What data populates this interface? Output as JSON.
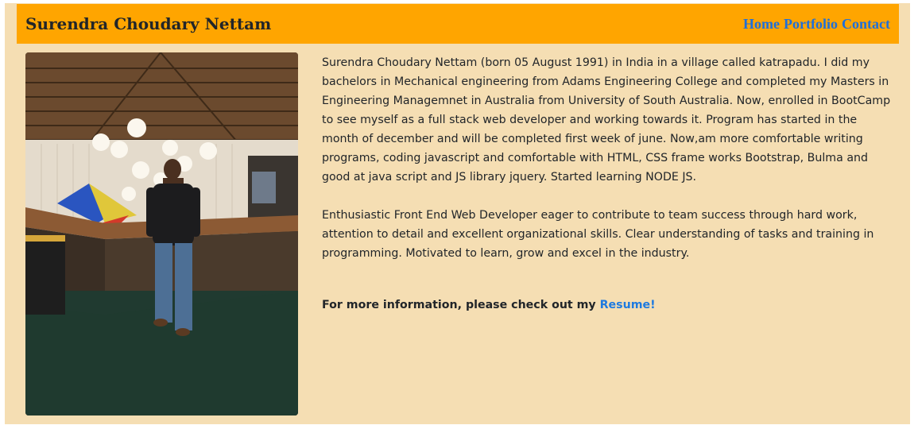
{
  "header": {
    "site_title": "Surendra Choudary Nettam",
    "nav": [
      {
        "label": "Home"
      },
      {
        "label": "Portfolio"
      },
      {
        "label": "Contact"
      }
    ]
  },
  "profile_photo": {
    "description_icon": "portrait-photo"
  },
  "bio": {
    "paragraph1": "Surendra Choudary Nettam (born 05 August 1991) in India in a village called katrapadu. I did my bachelors in Mechanical engineering from Adams Engineering College and completed my Masters in Engineering Managemnet in Australia from University of South Australia. Now, enrolled in BootCamp to see myself as a full stack web developer and working towards it. Program has started in the month of december and will be completed first week of june. Now,am more comfortable writing programs, coding javascript and comfortable with HTML, CSS frame works Bootstrap, Bulma and good at java script and JS library jquery. Started learning NODE JS.",
    "paragraph2": "Enthusiastic Front End Web Developer eager to contribute to team success through hard work, attention to detail and excellent organizational skills. Clear understanding of tasks and training in programming. Motivated to learn, grow and excel in the industry."
  },
  "more_info": {
    "text": "For more information, please check out my ",
    "link_label": "Resume!"
  },
  "colors": {
    "page_background": "#f5deb3",
    "header_background": "#ffa500",
    "link": "#1e6fd9"
  }
}
